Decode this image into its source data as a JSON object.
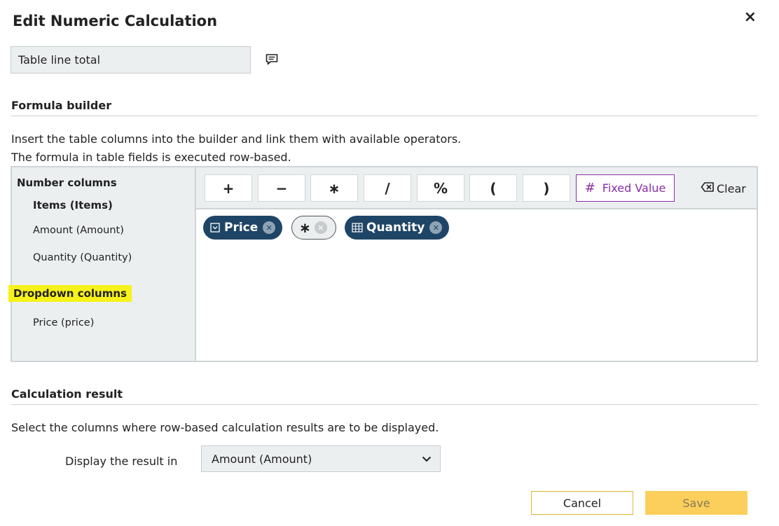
{
  "dialog": {
    "title": "Edit Numeric Calculation",
    "close_label": "×"
  },
  "name_field": {
    "value": "Table line total"
  },
  "formula_builder": {
    "heading": "Formula builder",
    "description_line1": "Insert the table columns into the builder and link them with available operators.",
    "description_line2": "The formula in table fields is executed row-based.",
    "left_panel": {
      "number_columns_heading": "Number columns",
      "table_name": "Items (Items)",
      "number_columns": [
        "Amount (Amount)",
        "Quantity (Quantity)"
      ],
      "dropdown_columns_heading": "Dropdown columns",
      "dropdown_columns": [
        "Price (price)"
      ]
    },
    "operators": [
      "+",
      "−",
      "∗",
      "/",
      "%",
      "(",
      ")"
    ],
    "fixed_value_label": "Fixed Value",
    "clear_label": "Clear",
    "tokens": [
      {
        "label": "Price",
        "kind": "dropdown-column"
      },
      {
        "label": "∗",
        "kind": "operator"
      },
      {
        "label": "Quantity",
        "kind": "number-column"
      }
    ]
  },
  "calculation_result": {
    "heading": "Calculation result",
    "description": "Select the columns where row-based calculation results are to be displayed.",
    "display_label": "Display the result in",
    "selected_value": "Amount (Amount)"
  },
  "footer": {
    "cancel_label": "Cancel",
    "save_label": "Save"
  },
  "colors": {
    "chip_dark": "#1f4566",
    "accent_purple": "#8a2da5",
    "save_yellow": "#fccf5c",
    "highlight_yellow": "#f6f21a"
  }
}
